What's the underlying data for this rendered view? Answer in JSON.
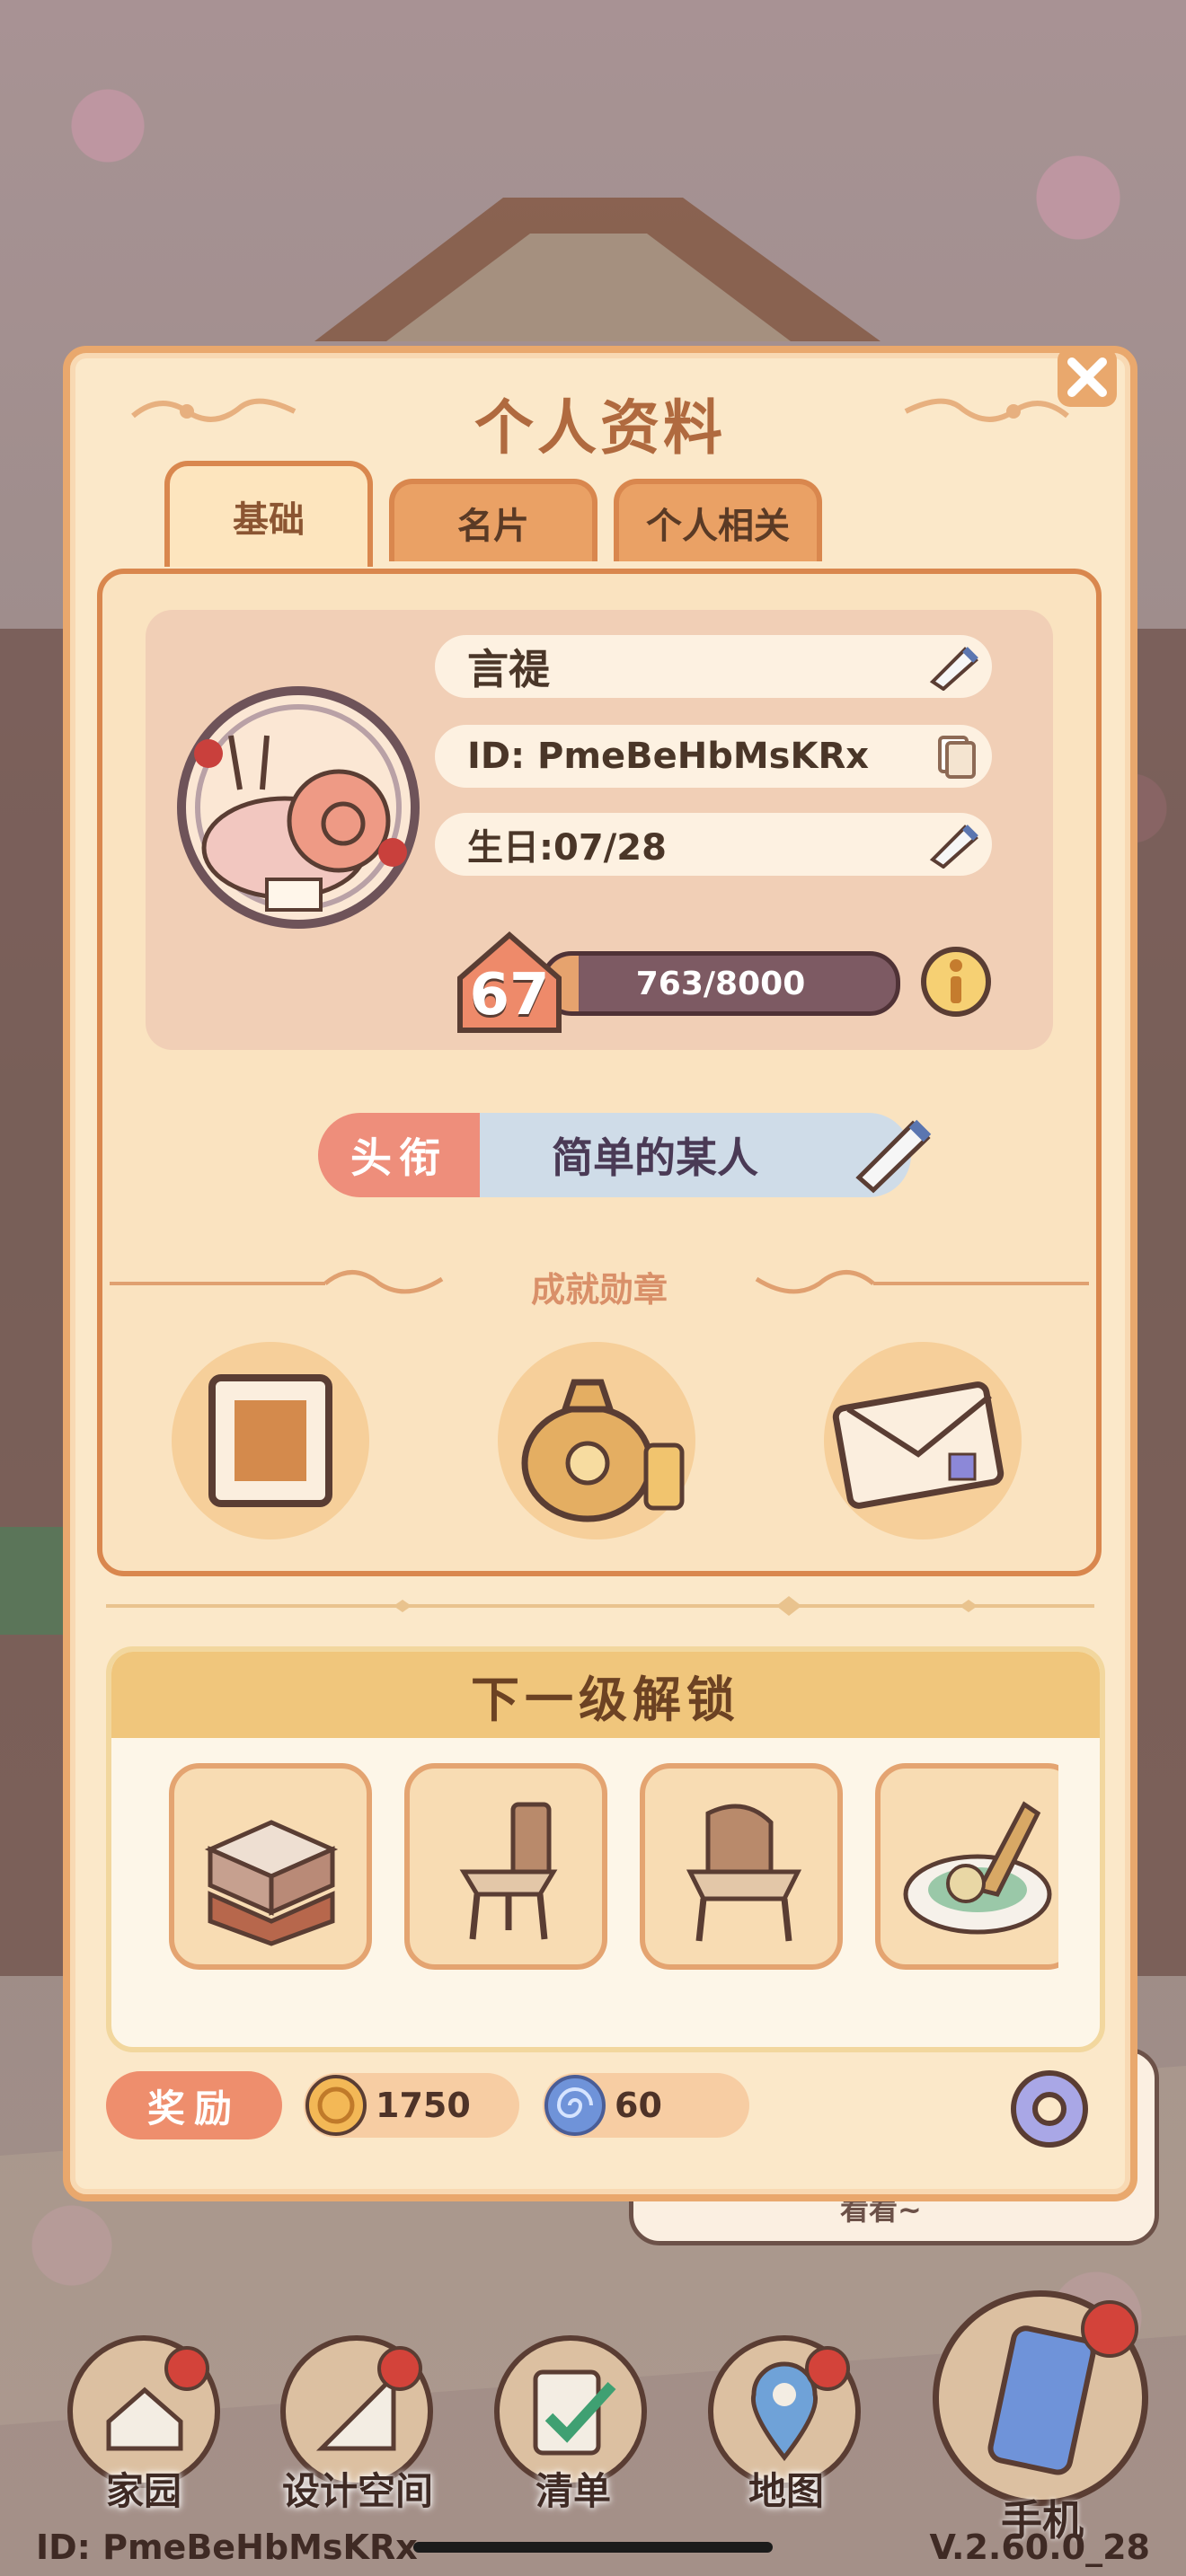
{
  "modal": {
    "title": "个人资料",
    "tabs": [
      {
        "label": "基础",
        "active": true
      },
      {
        "label": "名片",
        "active": false
      },
      {
        "label": "个人相关",
        "active": false
      }
    ]
  },
  "profile": {
    "name": "言禔",
    "id_text": "ID: PmeBeHbMsKRx",
    "birthday": "生日:07/28",
    "level": "67",
    "xp": "763/8000",
    "xp_progress": 0.095
  },
  "title_badge": {
    "tag": "头衔",
    "value": "简单的某人"
  },
  "achievements": {
    "label": "成就勋章",
    "medals": [
      "stamp-medal-icon",
      "money-bag-medal-icon",
      "letter-medal-icon"
    ]
  },
  "unlock": {
    "header": "下一级解锁",
    "items": [
      "block-icon",
      "chair-icon",
      "armchair-icon",
      "dish-icon"
    ]
  },
  "rewards": {
    "label": "奖励",
    "coins": "1750",
    "gems": "60"
  },
  "background": {
    "bubble_text": "看看~"
  },
  "nav": {
    "items": [
      {
        "label": "家园"
      },
      {
        "label": "设计空间"
      },
      {
        "label": "清单"
      },
      {
        "label": "地图"
      },
      {
        "label": "手机"
      }
    ],
    "footer_id": "ID: PmeBeHbMsKRx",
    "version": "V.2.60.0_28"
  },
  "colors": {
    "modal_bg": "#fbe8c9",
    "accent": "#d9874e",
    "title": "#b06a3f",
    "badge_red": "#d3433a"
  }
}
